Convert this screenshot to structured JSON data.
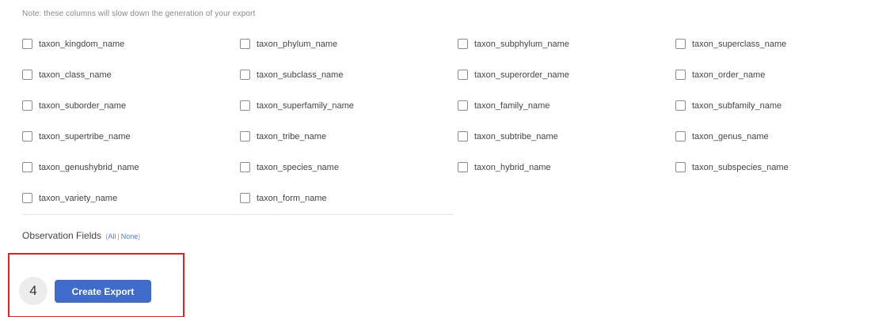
{
  "note": "Note: these columns will slow down the generation of your export",
  "columns": [
    [
      "taxon_kingdom_name",
      "taxon_phylum_name",
      "taxon_subphylum_name",
      "taxon_superclass_name"
    ],
    [
      "taxon_class_name",
      "taxon_subclass_name",
      "taxon_superorder_name",
      "taxon_order_name"
    ],
    [
      "taxon_suborder_name",
      "taxon_superfamily_name",
      "taxon_family_name",
      "taxon_subfamily_name"
    ],
    [
      "taxon_supertribe_name",
      "taxon_tribe_name",
      "taxon_subtribe_name",
      "taxon_genus_name"
    ],
    [
      "taxon_genushybrid_name",
      "taxon_species_name",
      "taxon_hybrid_name",
      "taxon_subspecies_name"
    ],
    [
      "taxon_variety_name",
      "taxon_form_name"
    ]
  ],
  "observation_fields": {
    "label": "Observation Fields",
    "open_paren": "(",
    "all_link": "All",
    "separator": "|",
    "none_link": "None",
    "close_paren": ")"
  },
  "export": {
    "step_number": "4",
    "button_label": "Create Export"
  },
  "colors": {
    "button_bg": "#3f6cca",
    "highlight_border": "#e8201f",
    "link": "#4a7cc9"
  }
}
